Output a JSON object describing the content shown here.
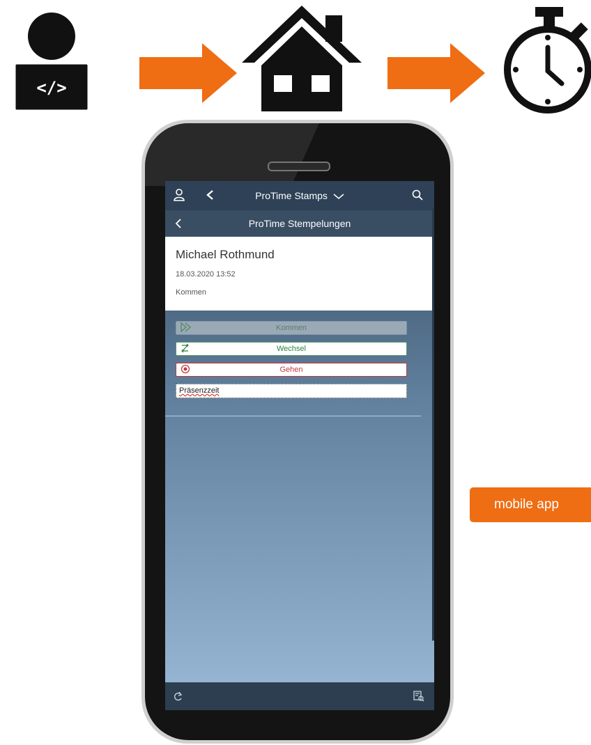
{
  "icons": {
    "developer": "developer-laptop-icon",
    "arrow": "right-arrow-icon",
    "home": "home-icon",
    "stopwatch": "stopwatch-icon"
  },
  "colors": {
    "accent_orange": "#ef6d13",
    "shell_bar": "#2e4156",
    "kommen_green": "#5c7f6a",
    "wechsel_green": "#2f7d3e",
    "gehen_red": "#c33a3a"
  },
  "app": {
    "shell_title": "ProTime Stamps",
    "sub_title": "ProTime Stempelungen",
    "header": {
      "name": "Michael Rothmund",
      "datetime": "18.03.2020 13:52",
      "status": "Kommen"
    },
    "buttons": {
      "kommen": "Kommen",
      "wechsel": "Wechsel",
      "gehen": "Gehen"
    },
    "input_value": "Präsenzzeit"
  },
  "badge": {
    "label": "mobile app"
  }
}
